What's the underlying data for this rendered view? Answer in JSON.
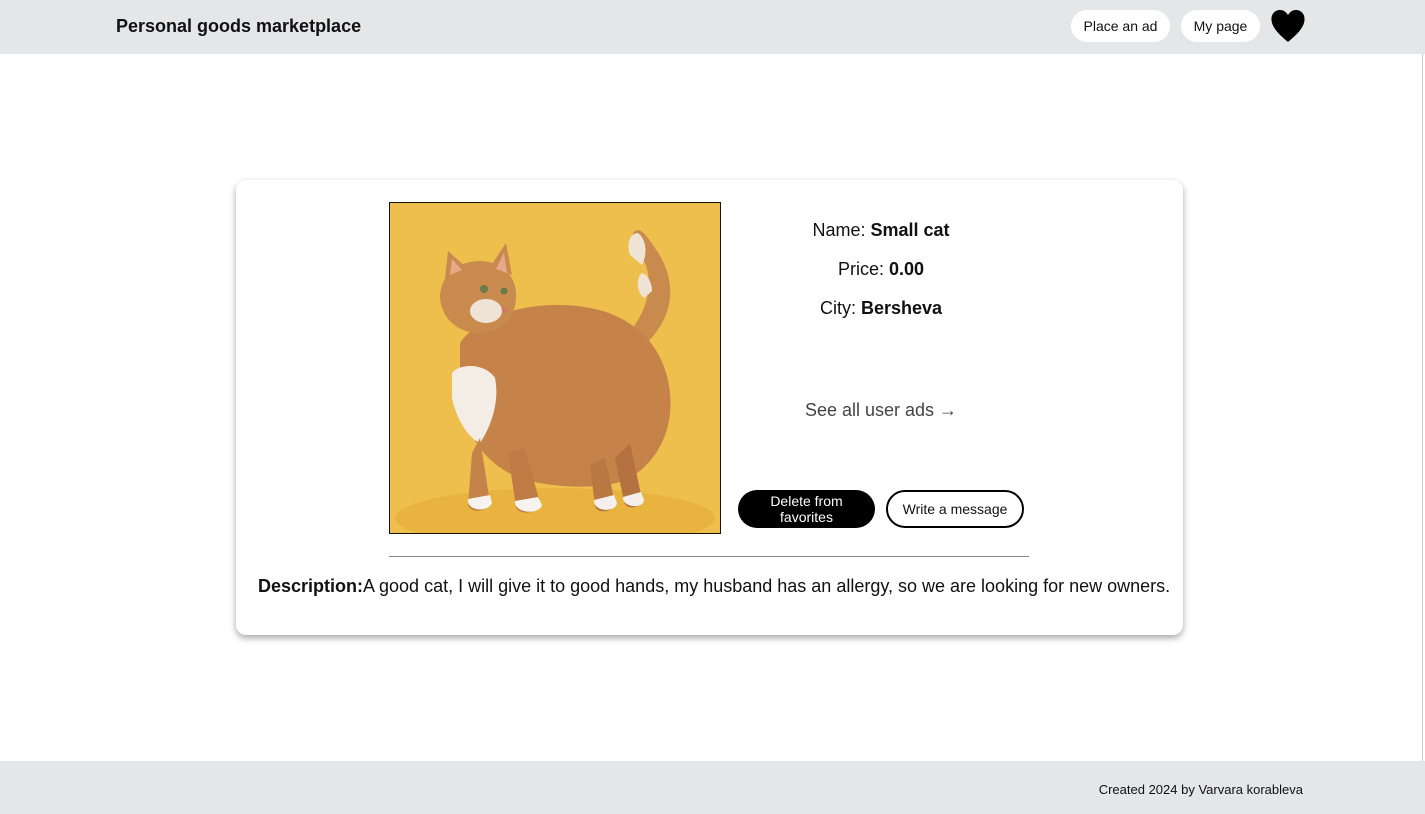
{
  "header": {
    "title": "Personal goods marketplace",
    "place_ad_label": "Place an ad",
    "my_page_label": "My page",
    "favorites_icon": "heart-icon"
  },
  "listing": {
    "image_alt": "cat-photo",
    "name_label": "Name: ",
    "name_value": "Small cat",
    "price_label": "Price: ",
    "price_value": "0.00",
    "city_label": "City: ",
    "city_value": "Bersheva",
    "user_ads_link": "See all user ads →",
    "delete_favorites_label": "Delete from favorites",
    "write_message_label": "Write a message",
    "description_label": "Description:",
    "description_text": "A good cat, I will give it to good hands, my husband has an allergy, so we are looking for new owners."
  },
  "footer": {
    "credit": "Created 2024 by Varvara korableva"
  },
  "colors": {
    "header_bg": "#e5e6e8",
    "footer_bg": "#e5e6e8",
    "photo_bg": "#efbf4e",
    "primary_button": "#000000"
  }
}
